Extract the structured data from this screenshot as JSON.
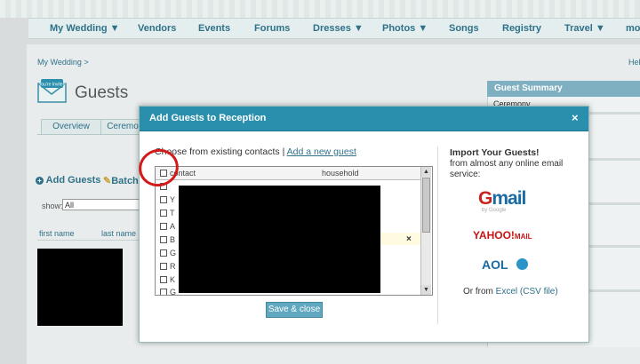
{
  "nav": {
    "items": [
      "My Wedding",
      "Vendors",
      "Events",
      "Forums",
      "Dresses",
      "Photos",
      "Songs",
      "Registry",
      "Travel",
      "mo"
    ],
    "dropdown_marker": "▼"
  },
  "breadcrumb": "My Wedding >",
  "help_link": "Hel",
  "logo_text": "You're Invited",
  "page_title": "Guests",
  "tabs": [
    "Overview",
    "Ceremo"
  ],
  "actions": {
    "add_guests": "Add Guests",
    "batch": "Batch"
  },
  "show": {
    "label": "show:",
    "value": "All"
  },
  "list_headers": {
    "first_name": "first name",
    "last_name": "last name"
  },
  "summary": {
    "title": "Guest Summary",
    "row1": "Ceremony"
  },
  "modal": {
    "title": "Add Guests to Reception",
    "close": "×",
    "choose_text": "Choose from existing contacts |",
    "add_new_guest": "Add a new guest",
    "columns": {
      "contact": "contact",
      "household": "household"
    },
    "row_letters": [
      "",
      "Y",
      "T",
      "A",
      "B",
      "G",
      "R",
      "K",
      "G"
    ],
    "remove_mark": "×",
    "save_button": "Save & close",
    "import": {
      "title": "Import Your Guests!",
      "desc": "from almost any online email service:",
      "gmail": "Gmail",
      "gmail_sub": "by Google",
      "yahoo": "YAHOO!",
      "yahoo_mail": "MAIL",
      "aol": "AOL",
      "or_from": "Or from",
      "excel": "Excel (CSV file)"
    }
  }
}
